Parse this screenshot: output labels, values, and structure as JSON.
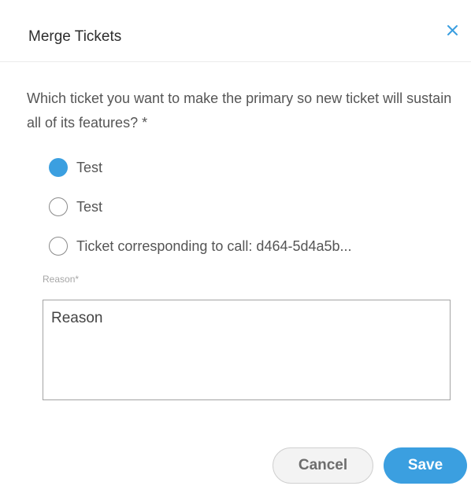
{
  "dialog": {
    "title": "Merge Tickets",
    "close_icon": "close-icon"
  },
  "question": {
    "text": "Which ticket you want to make the primary so new ticket will sustain all of its features? *"
  },
  "options": [
    {
      "label": "Test",
      "selected": true
    },
    {
      "label": "Test",
      "selected": false
    },
    {
      "label": "Ticket corresponding to call: d464-5d4a5b...",
      "selected": false
    }
  ],
  "reason": {
    "label": "Reason*",
    "value": "Reason"
  },
  "buttons": {
    "cancel_label": "Cancel",
    "save_label": "Save"
  },
  "colors": {
    "accent": "#3b9fe0",
    "close_icon": "#3b9fe0"
  }
}
